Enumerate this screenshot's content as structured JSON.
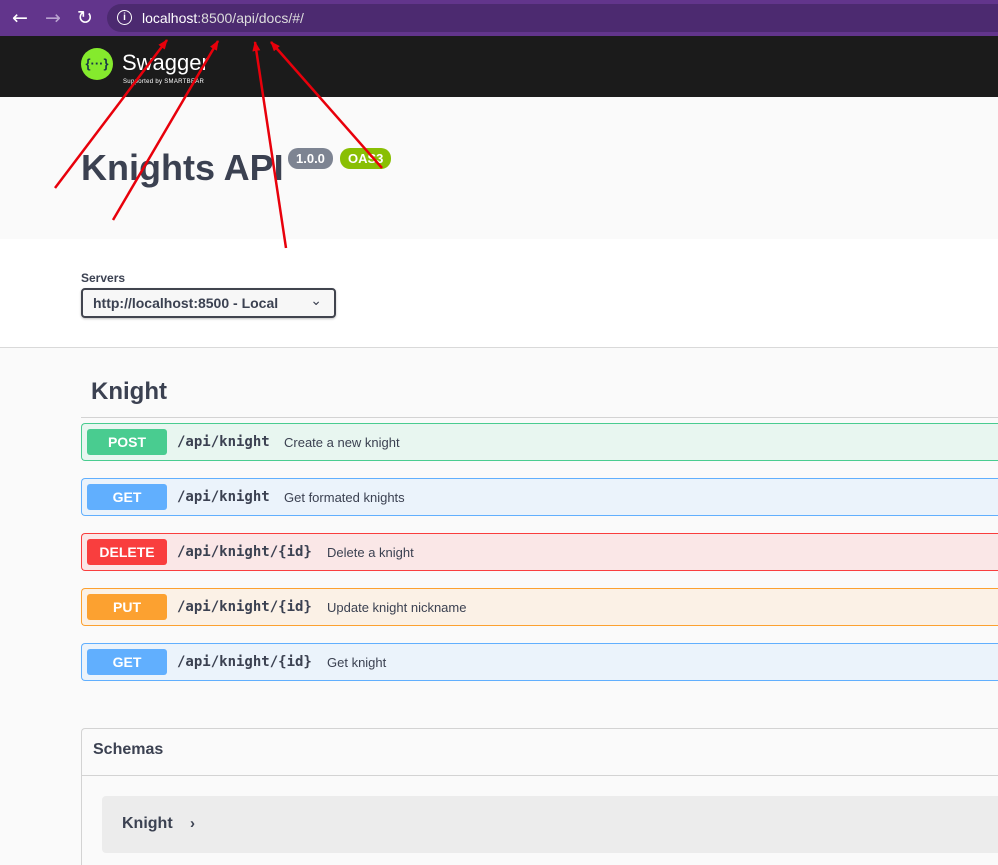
{
  "browser": {
    "back_icon": "←",
    "forward_icon": "→",
    "reload_icon": "↻",
    "url_host": "localhost",
    "url_rest": ":8500/api/docs/#/"
  },
  "swagger": {
    "logo_glyph": "{···}",
    "logo_name": "Swagger",
    "logo_tagline": "Supported by SMARTBEAR"
  },
  "info": {
    "title": "Knights API",
    "version": "1.0.0",
    "oas": "OAS3"
  },
  "servers": {
    "label": "Servers",
    "selected": "http://localhost:8500 - Local",
    "chevron": "⌄"
  },
  "tag": {
    "name": "Knight",
    "operations": [
      {
        "method": "POST",
        "path": "/api/knight",
        "summary": "Create a new knight"
      },
      {
        "method": "GET",
        "path": "/api/knight",
        "summary": "Get formated knights"
      },
      {
        "method": "DELETE",
        "path": "/api/knight/{id}",
        "summary": "Delete a knight"
      },
      {
        "method": "PUT",
        "path": "/api/knight/{id}",
        "summary": "Update knight nickname"
      },
      {
        "method": "GET",
        "path": "/api/knight/{id}",
        "summary": "Get knight"
      }
    ]
  },
  "schemas": {
    "title": "Schemas",
    "models": [
      {
        "name": "Knight",
        "chevron": "›"
      }
    ]
  },
  "colors": {
    "browser_bar": "#62358c",
    "post": "#49cc90",
    "get": "#61affe",
    "delete": "#f93e3e",
    "put": "#fca130",
    "annotation_arrow": "#e8000b"
  }
}
